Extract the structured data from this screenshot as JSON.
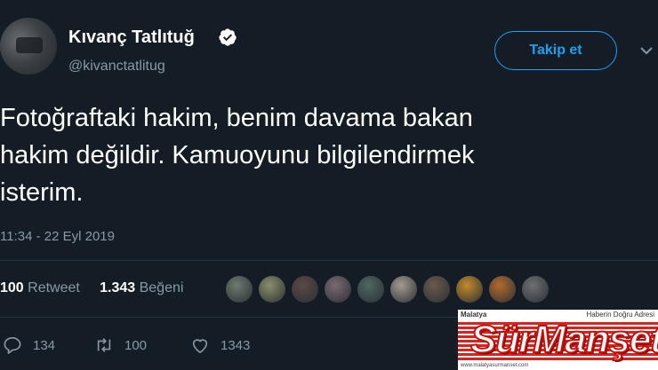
{
  "user": {
    "name": "Kıvanç Tatlıtuğ",
    "handle": "@kivanctatlitug"
  },
  "follow_label": "Takip et",
  "tweet": {
    "lines": [
      "Fotoğraftaki hakim, benim davama bakan",
      "hakim değildir. Kamuoyunu bilgilendirmek",
      "isterim."
    ],
    "timestamp": "11:34 - 22 Eyl 2019"
  },
  "stats": {
    "retweets": "100",
    "retweet_label": "Retweet",
    "likes": "1.343",
    "like_label": "Beğeni"
  },
  "likers": [
    "#6d7a6e",
    "#8a8f6a",
    "#5c4a45",
    "#7b6a72",
    "#4f6660",
    "#a39b90",
    "#6a5a4c",
    "#c48a2a",
    "#b46a2c",
    "#6d6f72"
  ],
  "actions": {
    "replies": "134",
    "retweets": "100",
    "likes": "1343"
  },
  "watermark": {
    "top_left": "Malatya",
    "top_right": "Haberin Doğru Adresi",
    "brand": "SürManşet",
    "url": "www.malatyasurmanset.com"
  },
  "colors": {
    "background": "#141d26",
    "accent": "#1da1f2",
    "muted": "#8899a6"
  }
}
